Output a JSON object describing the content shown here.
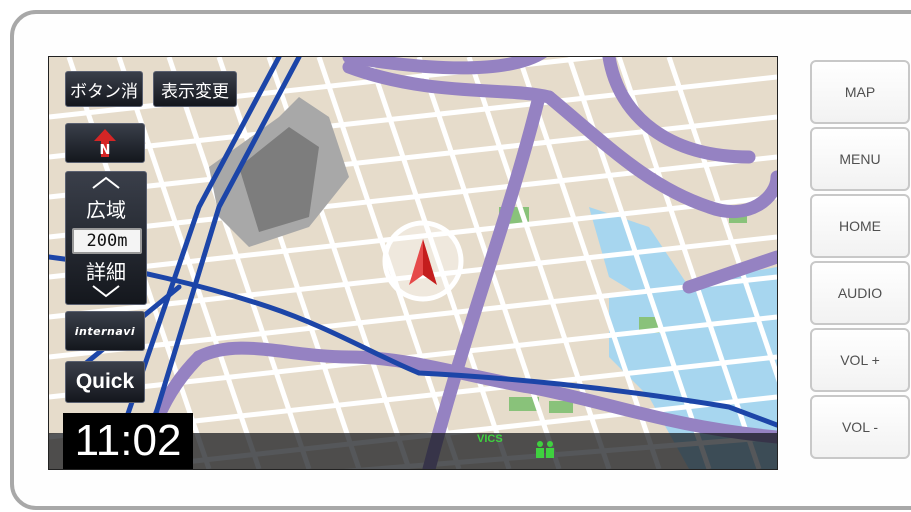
{
  "map_controls": {
    "hide_buttons_label": "ボタン消",
    "display_change_label": "表示変更",
    "north_label": "N",
    "zoom_wide_label": "広域",
    "scale_label": "200m",
    "zoom_detail_label": "詳細",
    "internavi_label": "internavi",
    "quick_label": "Quick"
  },
  "status": {
    "clock": "11:02",
    "vics_label": "VICS"
  },
  "side_buttons": {
    "map": "MAP",
    "menu": "MENU",
    "home": "HOME",
    "audio": "AUDIO",
    "vol_up": "VOL +",
    "vol_down": "VOL -"
  },
  "colors": {
    "map_land": "#e6dccb",
    "map_road": "#ffffff",
    "expressway": "#9582c2",
    "route": "#1c45a8",
    "water": "#a7d6ef",
    "park": "#89c27a",
    "building": "#7d7d7d"
  },
  "icons": {
    "north_arrow": "north-arrow-icon",
    "zoom_out": "chevron-up-icon",
    "zoom_in": "chevron-down-icon",
    "vehicle": "vehicle-position-icon",
    "vics_people": "vics-people-icon"
  }
}
